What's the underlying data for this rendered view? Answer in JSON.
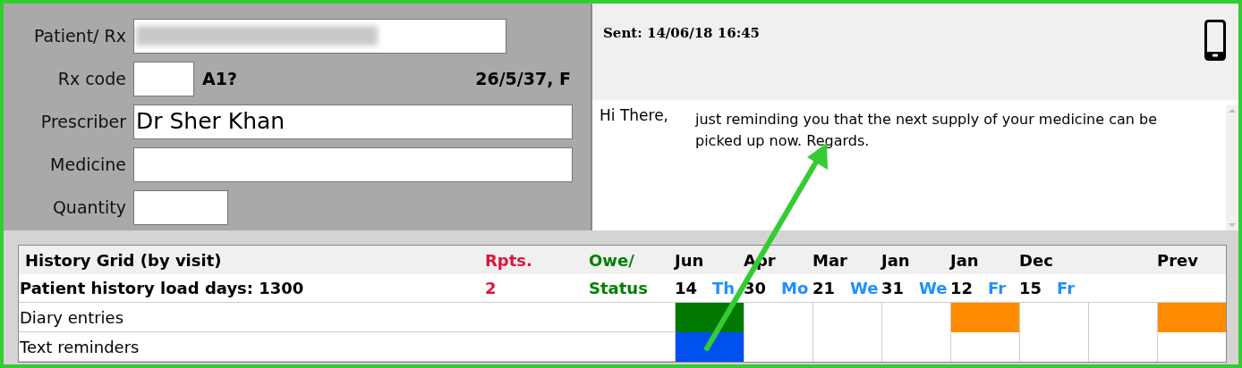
{
  "form": {
    "fields": [
      {
        "label": "Patient/ Rx",
        "kind": "long",
        "redacted": true
      },
      {
        "label": "Rx code",
        "kind": "tiny",
        "redacted": false
      },
      {
        "label": "Prescriber",
        "kind": "full",
        "value": "Dr Sher Khan",
        "redacted": false
      },
      {
        "label": "Medicine",
        "kind": "full",
        "redacted": false
      },
      {
        "label": "Quantity",
        "kind": "short",
        "redacted": false
      }
    ],
    "code_hint": "A1?",
    "patient_info": "26/5/37, F"
  },
  "message": {
    "sent": "Sent: 14/06/18 16:45",
    "greeting": "Hi There,",
    "body": "just reminding you that the next supply of your medicine can be picked up now. Regards."
  },
  "history": {
    "title": "History Grid (by visit)",
    "load_days": "Patient history load days: 1300",
    "rpts_label": "Rpts.",
    "rpts_value": "2",
    "owe_label": "Owe/",
    "status_label": "Status",
    "visits": [
      {
        "kind": "date",
        "month": "Jun",
        "day": "14",
        "weekday": "Th"
      },
      {
        "kind": "date",
        "month": "Apr",
        "day": "30",
        "weekday": "Mo"
      },
      {
        "kind": "date",
        "month": "Mar",
        "day": "21",
        "weekday": "We"
      },
      {
        "kind": "date",
        "month": "Jan",
        "day": "31",
        "weekday": "We"
      },
      {
        "kind": "date",
        "month": "Jan",
        "day": "12",
        "weekday": "Fr"
      },
      {
        "kind": "date",
        "month": "Dec",
        "day": "15",
        "weekday": "Fr"
      },
      {
        "kind": "empty"
      },
      {
        "kind": "prev",
        "month": "Prev"
      }
    ],
    "rows": [
      {
        "label": "Diary entries",
        "cells": [
          {
            "filled": true,
            "color": "#007800"
          },
          {
            "filled": false
          },
          {
            "filled": false
          },
          {
            "filled": false
          },
          {
            "filled": true,
            "color": "#ff8c00"
          },
          {
            "filled": false
          },
          {
            "filled": false
          },
          {
            "filled": true,
            "color": "#ff8c00"
          }
        ]
      },
      {
        "label": "Text reminders",
        "cells": [
          {
            "filled": true,
            "color": "#0050f0"
          },
          {
            "filled": false
          },
          {
            "filled": false
          },
          {
            "filled": false
          },
          {
            "filled": false
          },
          {
            "filled": false
          },
          {
            "filled": false
          },
          {
            "filled": false
          }
        ]
      }
    ]
  }
}
